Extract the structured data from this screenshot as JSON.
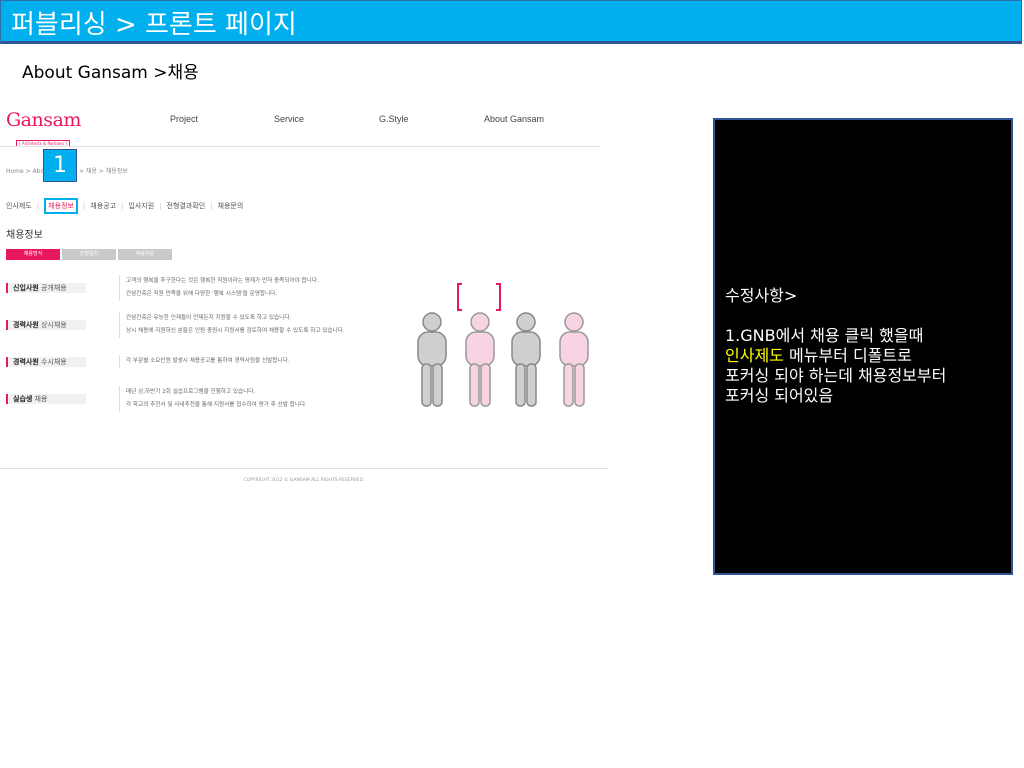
{
  "slide": {
    "title": "퍼블리싱 > 프론트 페이지",
    "subtitle": "About Gansam >채용"
  },
  "site": {
    "logo": {
      "name": "Gansam",
      "tagline": "[ Architects & Partners ]"
    },
    "gnb": [
      "Project",
      "Service",
      "G.Style",
      "About Gansam"
    ],
    "breadcrumb": "Home > About Gansam > 채용 > 채용정보",
    "marker_number": "1",
    "lnb": [
      "인사제도",
      "채용정보",
      "채용공고",
      "입사지원",
      "전형결과확인",
      "채용문의"
    ],
    "section_title": "채용정보",
    "tabs": [
      "채용방식",
      "전형절차",
      "채용부문"
    ],
    "rows": [
      {
        "label_bold": "신입사원",
        "label_rest": " 공개채용",
        "lines": [
          "고객의 행복을 추구한다는 것은 행복한 직원이라는 명제가 먼저 충족되어야 합니다.",
          "간삼건축은 직원 만족을 위해 다양한 '행복 시스템'을 운영합니다."
        ]
      },
      {
        "label_bold": "경력사원",
        "label_rest": " 상시채용",
        "lines": [
          "간삼건축은 유능한 인재들이 언제든지 지원할 수 있도록 하고 있습니다.",
          "상시 채용에 지원하신 분들은 인원 충원시 지원서를 검토하여 채용할 수 있도록 하고 있습니다."
        ]
      },
      {
        "label_bold": "경력사원",
        "label_rest": " 수시채용",
        "lines": [
          "각 부문별 소요인원 발생시 채용공고를 통하여 경력사원을 선발합니다."
        ]
      },
      {
        "label_bold": "실습생",
        "label_rest": " 채용",
        "lines": [
          "매년 상,하반기 2회 실습프로그램을 진행하고 있습니다.",
          "각 학교의 추천서 및 사내추천을 통해 지원서를 접수하여 평가 후 선발 합니다."
        ]
      }
    ],
    "copyright": "COPYRIGHT 2012 © GANSAM ALL RIGHTS RESERVED."
  },
  "notes": {
    "heading": "수정사항>",
    "line1": "1.GNB에서 채용 클릭 했을때",
    "line2_highlight": "인사제도",
    "line2_rest": " 메뉴부터 디폴트로",
    "line3": "포커싱 되야 하는데 채용정보부터",
    "line4": "포커싱 되어있음"
  },
  "colors": {
    "header": "#00b0ee",
    "brand": "#e8185e",
    "highlight": "#ffff00",
    "notes_bg": "#000000"
  }
}
